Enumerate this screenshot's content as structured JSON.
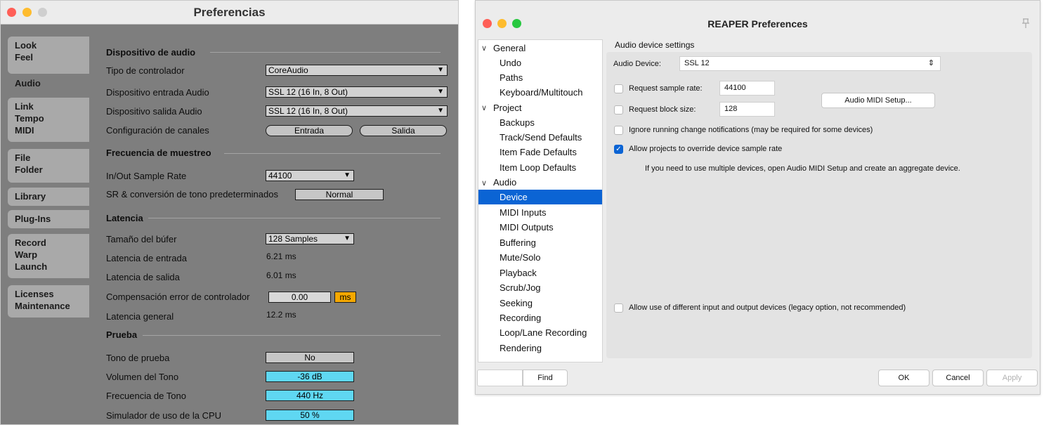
{
  "ableton": {
    "title": "Preferencias",
    "sidebar": [
      {
        "lines": [
          "Look",
          "Feel"
        ]
      },
      {
        "lines": [
          "Audio"
        ]
      },
      {
        "lines": [
          "Link",
          "Tempo",
          "MIDI"
        ]
      },
      {
        "lines": [
          "File",
          "Folder"
        ]
      },
      {
        "lines": [
          "Library"
        ]
      },
      {
        "lines": [
          "Plug-Ins"
        ]
      },
      {
        "lines": [
          "Record",
          "Warp",
          "Launch"
        ]
      },
      {
        "lines": [
          "Licenses",
          "Maintenance"
        ]
      }
    ],
    "sections": {
      "audio_device": "Dispositivo de audio",
      "sample_rate": "Frecuencia de muestreo",
      "latency": "Latencia",
      "test": "Prueba"
    },
    "rows": {
      "driver_type": {
        "label": "Tipo de controlador",
        "value": "CoreAudio"
      },
      "input_device": {
        "label": "Dispositivo entrada Audio",
        "value": "SSL 12 (16 In, 8 Out)"
      },
      "output_device": {
        "label": "Dispositivo salida Audio",
        "value": "SSL 12 (16 In, 8 Out)"
      },
      "channel_config": {
        "label": "Configuración de canales",
        "input_button": "Entrada",
        "output_button": "Salida"
      },
      "io_rate": {
        "label": "In/Out Sample Rate",
        "value": "44100"
      },
      "sr_conversion": {
        "label": "SR & conversión de tono predeterminados",
        "value": "Normal"
      },
      "buffer_size": {
        "label": "Tamaño del búfer",
        "value": "128 Samples"
      },
      "input_latency": {
        "label": "Latencia de entrada",
        "value": "6.21 ms"
      },
      "output_latency": {
        "label": "Latencia de salida",
        "value": "6.01 ms"
      },
      "driver_comp": {
        "label": "Compensación error de controlador",
        "value": "0.00",
        "unit": "ms"
      },
      "overall_latency": {
        "label": "Latencia general",
        "value": "12.2 ms"
      },
      "test_tone": {
        "label": "Tono de prueba",
        "value": "No"
      },
      "tone_volume": {
        "label": "Volumen del Tono",
        "value": "-36",
        "unit": "dB"
      },
      "tone_freq": {
        "label": "Frecuencia de Tono",
        "value": "440",
        "unit": "Hz"
      },
      "cpu_sim": {
        "label": "Simulador de uso de la CPU",
        "value": "50",
        "unit": "%"
      }
    }
  },
  "reaper": {
    "title": "REAPER Preferences",
    "tree": {
      "general": "General",
      "undo": "Undo",
      "paths": "Paths",
      "keyboard": "Keyboard/Multitouch",
      "project": "Project",
      "backups": "Backups",
      "track_send": "Track/Send Defaults",
      "item_fade": "Item Fade Defaults",
      "item_loop": "Item Loop Defaults",
      "audio": "Audio",
      "device": "Device",
      "midi_inputs": "MIDI Inputs",
      "midi_outputs": "MIDI Outputs",
      "buffering": "Buffering",
      "mute_solo": "Mute/Solo",
      "playback": "Playback",
      "scrub_jog": "Scrub/Jog",
      "seeking": "Seeking",
      "recording": "Recording",
      "loop_lane": "Loop/Lane Recording",
      "rendering": "Rendering"
    },
    "group_title": "Audio device settings",
    "audio_device_label": "Audio Device:",
    "audio_device_value": "SSL 12",
    "request_rate_label": "Request sample rate:",
    "request_rate_value": "44100",
    "request_block_label": "Request block size:",
    "request_block_value": "128",
    "midi_setup_button": "Audio MIDI Setup...",
    "ignore_label": "Ignore running change notifications (may be required for some devices)",
    "allow_override_label": "Allow projects to override device sample rate",
    "hint": "If you need to use multiple devices, open Audio MIDI Setup and create an aggregate device.",
    "allow_different_label": "Allow use of different input and output devices (legacy option, not recommended)",
    "find_button": "Find",
    "ok_button": "OK",
    "cancel_button": "Cancel",
    "apply_button": "Apply"
  }
}
